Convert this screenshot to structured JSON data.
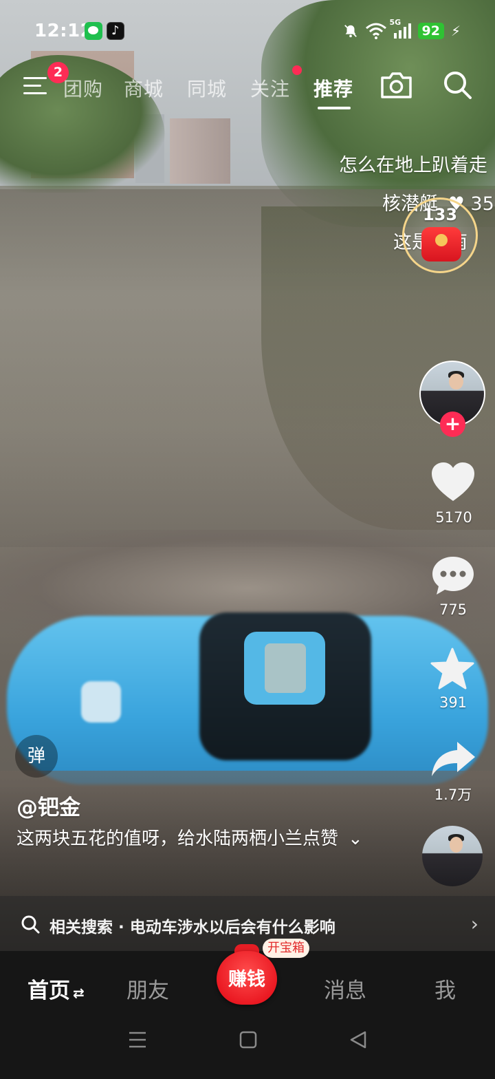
{
  "status_bar": {
    "time": "12:12",
    "network": "5G",
    "battery": "92"
  },
  "top_nav": {
    "notification_count": "2",
    "tabs": [
      "团购",
      "商城",
      "同城",
      "关注",
      "推荐"
    ],
    "active_tab": "推荐"
  },
  "floating": {
    "line1": "怎么在地上趴着走",
    "line2_user": "核潜艇",
    "line2_count": "35",
    "line3": "这是河南",
    "red_packet_count": "133"
  },
  "actions": {
    "likes": "5170",
    "comments": "775",
    "favorites": "391",
    "shares": "1.7万"
  },
  "video": {
    "danmaku_button": "弹",
    "author": "@钯金",
    "description": "这两块五花的值呀，给水陆两栖小兰点赞"
  },
  "related_search": {
    "text": "相关搜索 · 电动车涉水以后会有什么影响"
  },
  "bottom_nav": {
    "home": "首页",
    "friends": "朋友",
    "earn": "赚钱",
    "earn_tag": "开宝箱",
    "messages": "消息",
    "me": "我"
  },
  "colors": {
    "accent": "#fe2c55",
    "battery": "#2fc233",
    "scooter": "#3aa4dd"
  }
}
